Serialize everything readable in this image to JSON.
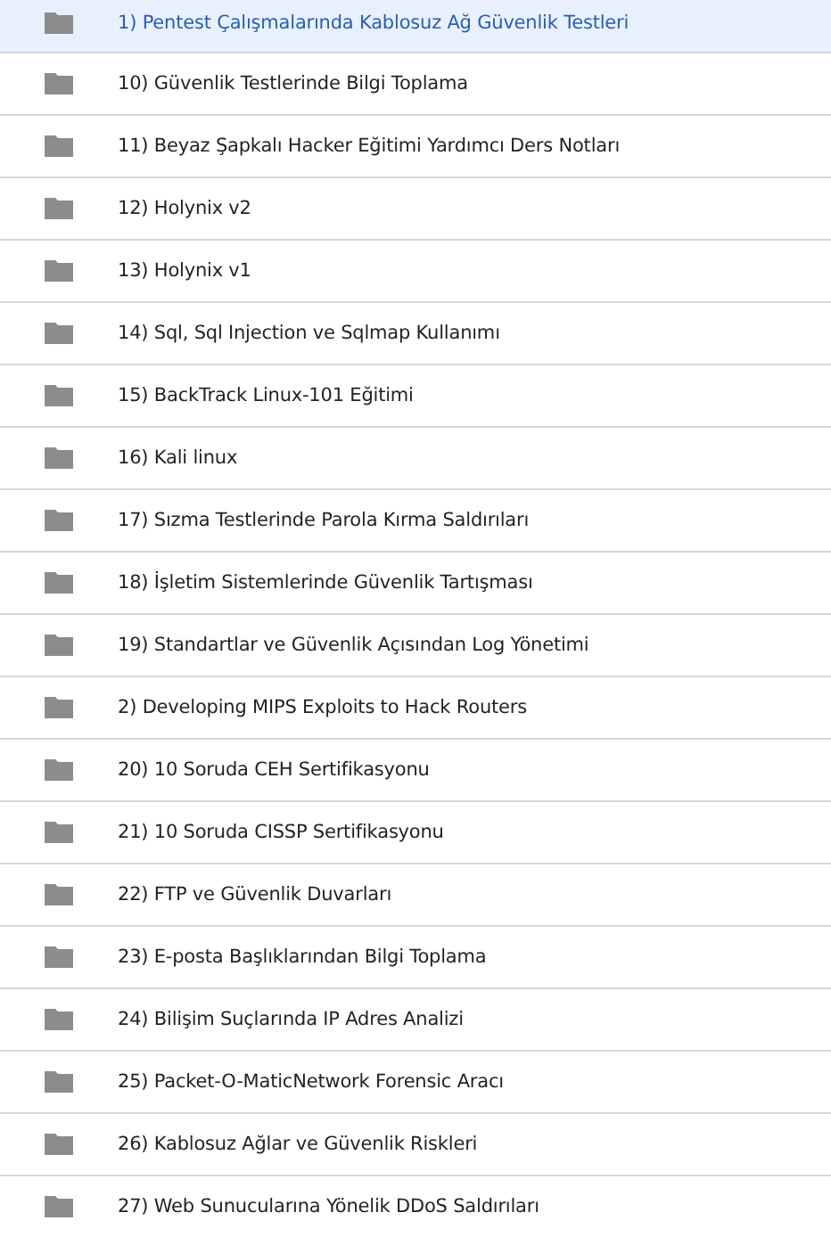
{
  "folders": [
    {
      "name": "1) Pentest Çalışmalarında Kablosuz Ağ Güvenlik Testleri",
      "selected": true
    },
    {
      "name": "10) Güvenlik Testlerinde Bilgi Toplama",
      "selected": false
    },
    {
      "name": "11) Beyaz Şapkalı Hacker Eğitimi Yardımcı Ders Notları",
      "selected": false
    },
    {
      "name": "12) Holynix v2",
      "selected": false
    },
    {
      "name": "13) Holynix v1",
      "selected": false
    },
    {
      "name": "14) Sql, Sql Injection ve Sqlmap Kullanımı",
      "selected": false
    },
    {
      "name": "15) BackTrack Linux-101 Eğitimi",
      "selected": false
    },
    {
      "name": "16) Kali linux",
      "selected": false
    },
    {
      "name": "17) Sızma Testlerinde Parola Kırma Saldırıları",
      "selected": false
    },
    {
      "name": "18) İşletim Sistemlerinde Güvenlik Tartışması",
      "selected": false
    },
    {
      "name": "19) Standartlar ve Güvenlik Açısından Log Yönetimi",
      "selected": false
    },
    {
      "name": "2) Developing MIPS Exploits to Hack Routers",
      "selected": false
    },
    {
      "name": "20) 10 Soruda CEH Sertifikasyonu",
      "selected": false
    },
    {
      "name": "21) 10 Soruda CISSP Sertifikasyonu",
      "selected": false
    },
    {
      "name": "22) FTP ve Güvenlik Duvarları",
      "selected": false
    },
    {
      "name": "23) E-posta Başlıklarından Bilgi Toplama",
      "selected": false
    },
    {
      "name": "24) Bilişim Suçlarında IP Adres Analizi",
      "selected": false
    },
    {
      "name": "25) Packet-O-MaticNetwork Forensic Aracı",
      "selected": false
    },
    {
      "name": "26) Kablosuz Ağlar ve Güvenlik Riskleri",
      "selected": false
    },
    {
      "name": "27) Web Sunucularına Yönelik DDoS Saldırıları",
      "selected": false
    }
  ]
}
